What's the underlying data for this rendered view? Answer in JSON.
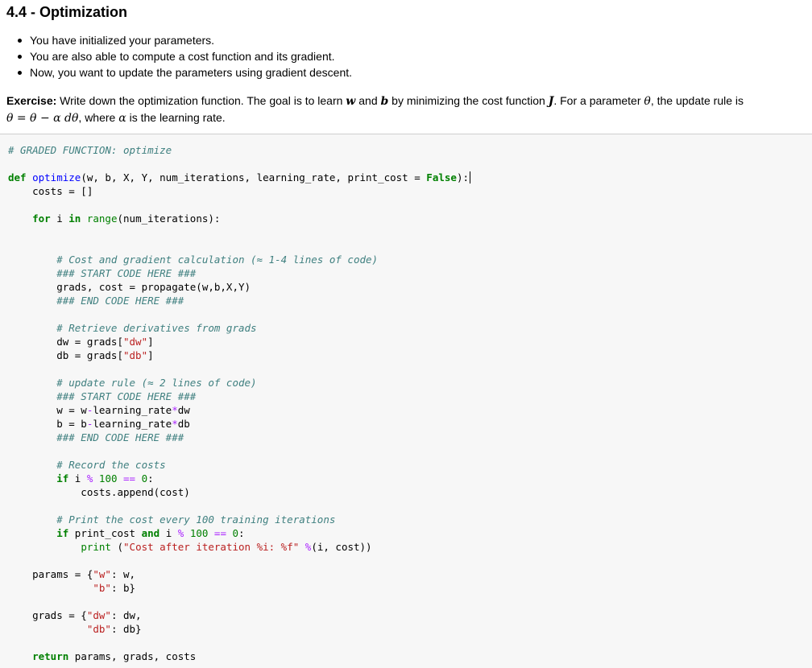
{
  "section": {
    "title": "4.4 - Optimization",
    "bullets": [
      "You have initialized your parameters.",
      "You are also able to compute a cost function and its gradient.",
      "Now, you want to update the parameters using gradient descent."
    ]
  },
  "exercise": {
    "label": "Exercise:",
    "text_a": " Write down the optimization function. The goal is to learn ",
    "w": "w",
    "and": " and ",
    "b": "b",
    "text_b": " by minimizing the cost function ",
    "J": "J",
    "text_c": ". For a parameter ",
    "theta": "θ",
    "text_d": ", the update rule is",
    "rule": "θ = θ − α dθ",
    "text_e": ", where ",
    "alpha": "α",
    "text_f": " is the learning rate."
  },
  "code": {
    "graded_comment": "# GRADED FUNCTION: optimize",
    "def": "def",
    "fn_name": "optimize",
    "sig": "(w, b, X, Y, num_iterations, learning_rate, print_cost = ",
    "false_kw": "False",
    "sig_end": "):",
    "costs_line": "    costs = []",
    "for_kw": "for",
    "for_var": " i ",
    "in_kw": "in",
    "range_fn": "range",
    "for_rest": "(num_iterations):",
    "c_cost": "        # Cost and gradient calculation (≈ 1-4 lines of code)",
    "c_start1": "        ### START CODE HERE ###",
    "grads_line": "        grads, cost = propagate(w,b,X,Y)",
    "c_end1": "        ### END CODE HERE ###",
    "c_retrieve": "        # Retrieve derivatives from grads",
    "dw_a": "        dw = grads[",
    "dw_key": "\"dw\"",
    "dw_b": "]",
    "db_a": "        db = grads[",
    "db_key": "\"db\"",
    "db_b": "]",
    "c_update": "        # update rule (≈ 2 lines of code)",
    "c_start2": "        ### START CODE HERE ###",
    "w_a": "        w = w",
    "minus": "-",
    "w_b": "learning_rate",
    "times": "*",
    "w_c": "dw",
    "b_a": "        b = b",
    "b_b": "learning_rate",
    "b_c": "db",
    "c_end2": "        ### END CODE HERE ###",
    "c_record": "        # Record the costs",
    "if_kw": "if",
    "if1_a": " i ",
    "mod": "%",
    "n100": "100",
    "eq": "==",
    "n0": "0",
    "colon": ":",
    "append_line": "            costs.append(cost)",
    "c_print": "        # Print the cost every 100 training iterations",
    "if2_a": " print_cost ",
    "and_kw": "and",
    "if2_b": " i ",
    "print_fn": "print",
    "print_str": "\"Cost after iteration %i: %f\"",
    "print_rest": "(i, cost))",
    "params_a": "    params = {",
    "key_w": "\"w\"",
    "params_b": ": w,",
    "key_b": "\"b\"",
    "params_c": ": b}",
    "grads_a": "    grads = {",
    "key_dw": "\"dw\"",
    "grads_b": ": dw,",
    "key_db": "\"db\"",
    "grads_c": ": db}",
    "return_kw": "return",
    "return_rest": " params, grads, costs"
  }
}
